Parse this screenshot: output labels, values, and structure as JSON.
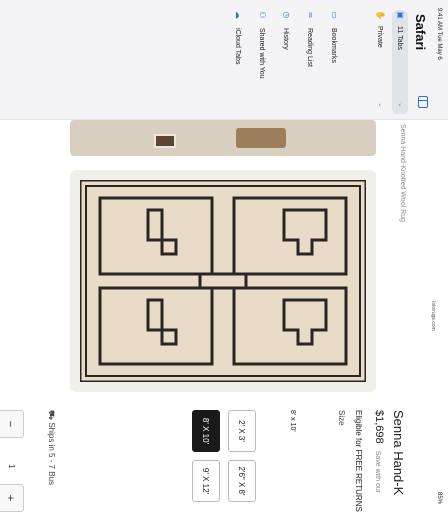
{
  "status": {
    "time": "9:41 AM",
    "date": "Tue May 6",
    "battery": "85%"
  },
  "sidebar": {
    "title": "Safari",
    "tabs_item": "11 Tabs",
    "private_item": "Private",
    "nav": [
      {
        "label": "Bookmarks",
        "icon": "book-icon"
      },
      {
        "label": "Reading List",
        "icon": "glasses-icon"
      },
      {
        "label": "History",
        "icon": "clock-icon"
      },
      {
        "label": "Shared with You",
        "icon": "people-icon"
      },
      {
        "label": "iCloud Tabs",
        "icon": "cloud-icon"
      }
    ]
  },
  "url": {
    "text": "loloirugs.com"
  },
  "breadcrumb": "Senna Hand-Knotted Wool Rug",
  "product": {
    "title": "Senna Hand-K",
    "price": "$1,698",
    "save": "Save with our",
    "free_returns": "Eligible for FREE RETURNS",
    "size_label": "Size",
    "size_current": "8' x 10'",
    "sizes": [
      "2' X 3'",
      "2'6\" X 8'",
      "8' X 10'",
      "9' X 12'"
    ],
    "ships": "Ships in 5 - 7 Bus",
    "qty_minus": "−",
    "qty_value": "1",
    "qty_plus": "+"
  },
  "colors": {
    "accent": "#2f6fd8",
    "rug_bg": "#e8dcc8",
    "rug_line": "#2a2622"
  }
}
